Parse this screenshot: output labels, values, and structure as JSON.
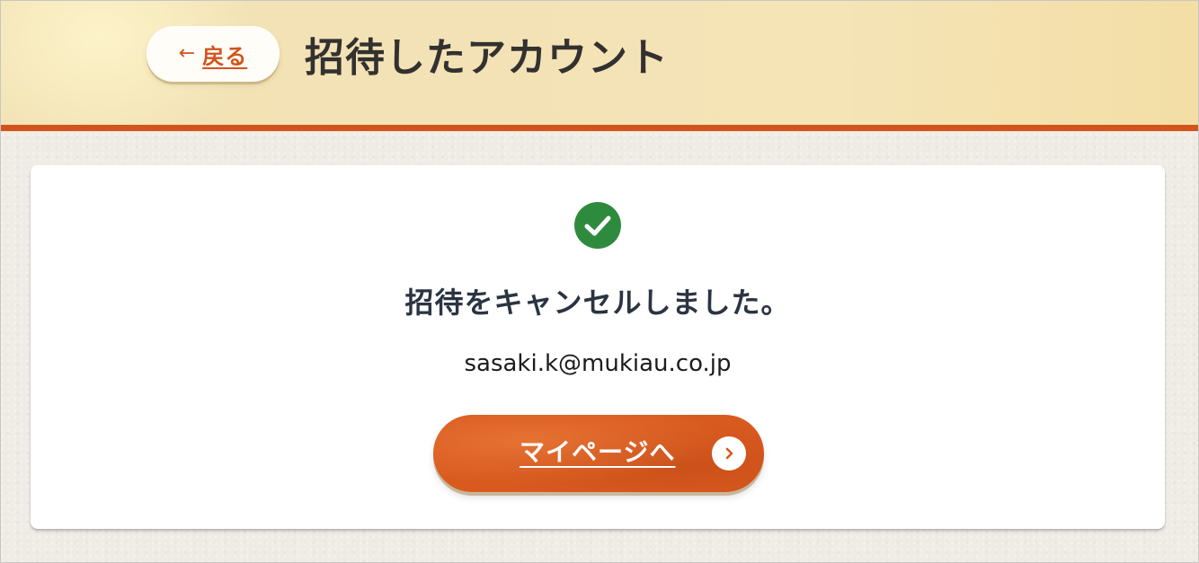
{
  "header": {
    "back_arrow": "←",
    "back_label": "戻る",
    "title": "招待したアカウント"
  },
  "card": {
    "status_icon": "check-circle-icon",
    "status_message": "招待をキャンセルしました。",
    "email": "sasaki.k@mukiau.co.jp",
    "mypage_button_label": "マイページへ",
    "mypage_button_icon": "chevron-right-icon"
  },
  "colors": {
    "accent": "#d2541a",
    "header_bg": "#f2e2b5",
    "success": "#2e8b3e",
    "page_bg": "#efebe5",
    "text": "#2b3442"
  }
}
